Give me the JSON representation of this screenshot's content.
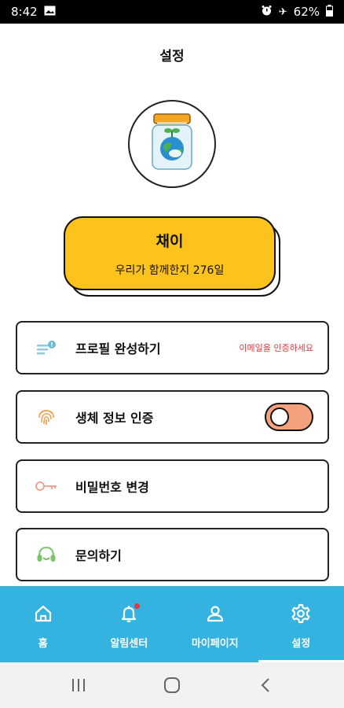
{
  "status_bar": {
    "time": "8:42",
    "battery": "62%",
    "icons": [
      "image-icon",
      "alarm-icon",
      "airplane-icon",
      "battery-icon"
    ]
  },
  "page": {
    "title": "설정"
  },
  "profile": {
    "avatar_icon": "jar-globe-icon",
    "name": "채이",
    "days_text": "우리가 함께한지 276일",
    "card_color": "#fbc31c"
  },
  "menu": {
    "profile_complete": {
      "label": "프로필 완성하기",
      "warning": "이메일을 인증하세요",
      "icon": "profile-list-icon"
    },
    "biometric": {
      "label": "생체 정보 인증",
      "icon": "fingerprint-icon",
      "toggle_on": false
    },
    "password": {
      "label": "비밀번호 변경",
      "icon": "key-icon"
    },
    "inquiry": {
      "label": "문의하기",
      "icon": "headset-icon"
    }
  },
  "bottom_nav": {
    "items": [
      {
        "label": "홈",
        "icon": "home-icon"
      },
      {
        "label": "알림센터",
        "icon": "bell-icon",
        "badge": true
      },
      {
        "label": "마이페이지",
        "icon": "user-icon"
      },
      {
        "label": "설정",
        "icon": "gear-icon",
        "active": true
      }
    ],
    "background": "#34b3e0"
  },
  "system_nav": {
    "icons": [
      "recents-icon",
      "home-circle-icon",
      "back-icon"
    ]
  },
  "colors": {
    "accent": "#fbc31c",
    "nav_blue": "#34b3e0",
    "warning": "#e8343c",
    "toggle": "#f4a27e"
  }
}
